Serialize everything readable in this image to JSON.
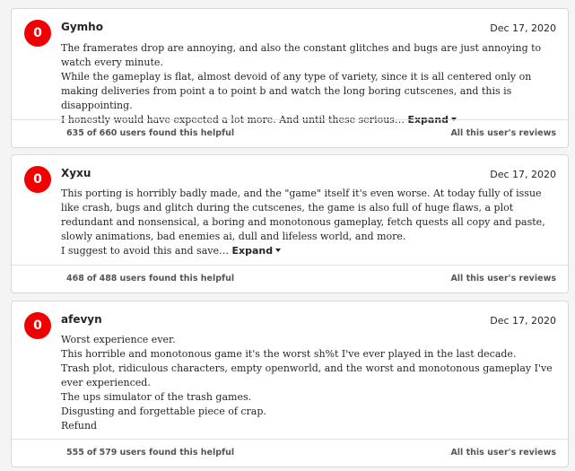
{
  "reviews": [
    {
      "score": "0",
      "author": "Gymho",
      "date": "Dec 17, 2020",
      "lines": [
        "The framerates drop are annoying, and also the constant glitches and bugs are just annoying to watch every minute.",
        "While the gameplay is flat, almost devoid of any type of variety, since it is all centered only on making deliveries from point a to point b and watch the long boring cutscenes, and this is disappointing.",
        "I honestly would have expected a lot more. And until these serious…"
      ],
      "expand_label": "Expand",
      "helpful_a": "635",
      "helpful_of": "of",
      "helpful_b": "660",
      "helpful_suffix": "users found this helpful",
      "all_reviews_label": "All this user's reviews"
    },
    {
      "score": "0",
      "author": "Xyxu",
      "date": "Dec 17, 2020",
      "lines": [
        "This porting is horribly badly made, and the \"game\" itself it's even worse. At today fully of issue like crash, bugs and glitch during the cutscenes, the game is also full of huge flaws, a plot redundant and nonsensical, a boring and monotonous gameplay, fetch quests all copy and paste, slowly animations, bad enemies ai, dull and lifeless world, and more.",
        "I suggest to avoid this and save…"
      ],
      "expand_label": "Expand",
      "helpful_a": "468",
      "helpful_of": "of",
      "helpful_b": "488",
      "helpful_suffix": "users found this helpful",
      "all_reviews_label": "All this user's reviews"
    },
    {
      "score": "0",
      "author": "afevyn",
      "date": "Dec 17, 2020",
      "lines": [
        "Worst experience ever.",
        "This horrible and monotonous game it's the worst sh%t I've ever played in the last decade.",
        "Trash plot, ridiculous characters, empty openworld, and the worst and monotonous gameplay I've ever experienced.",
        "The ups simulator of the trash games.",
        "Disgusting and forgettable piece of crap.",
        "Refund"
      ],
      "expand_label": "",
      "helpful_a": "555",
      "helpful_of": "of",
      "helpful_b": "579",
      "helpful_suffix": "users found this helpful",
      "all_reviews_label": "All this user's reviews"
    }
  ],
  "colors": {
    "negative_score": "#f00000",
    "text": "#262626",
    "muted": "#666666"
  }
}
